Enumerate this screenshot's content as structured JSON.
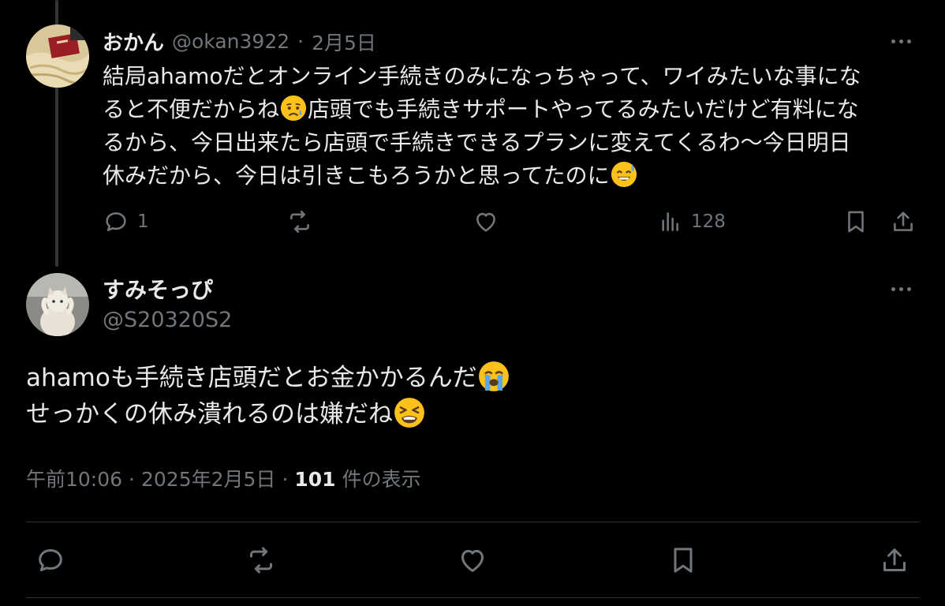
{
  "parent_tweet": {
    "display_name": "おかん",
    "handle": "@okan3922",
    "separator": "·",
    "date": "2月5日",
    "text_parts": [
      "結局ahamoだとオンライン手続きのみになっちゃって、ワイみたいな事にな",
      "ると不便だからね",
      "店頭でも手続きサポートやってるみたいだけど有料にな",
      "るから、今日出来たら店頭で手続きできるプランに変えてくるわ〜今日明日",
      "休みだから、今日は引きこもろうかと思ってたのに"
    ],
    "emojis": [
      "sad-relieved-face-emoji",
      "grinning-sweat-face-emoji"
    ],
    "reply_count": "1",
    "views_count": "128",
    "actions": [
      "reply-icon",
      "retweet-icon",
      "like-icon",
      "views-icon",
      "bookmark-icon",
      "share-icon"
    ]
  },
  "reply_tweet": {
    "display_name": "すみそっぴ",
    "handle": "@S20320S2",
    "text_line1": "ahamoも手続き店頭だとお金かかるんだ",
    "text_line2": "せっかくの休み潰れるのは嫌だね",
    "emojis": [
      "loudly-crying-face-emoji",
      "tired-face-emoji"
    ],
    "meta": {
      "time": "午前10:06",
      "separator": "·",
      "date": "2025年2月5日",
      "separator2": "·",
      "views_count": "101",
      "views_label": "件の表示"
    },
    "actions": [
      "reply-icon",
      "retweet-icon",
      "like-icon",
      "bookmark-icon",
      "share-icon"
    ]
  },
  "colors": {
    "background": "#000000",
    "text_primary": "#e7e9ea",
    "text_secondary": "#71767b",
    "divider": "#2f3336",
    "thread_line": "#333639"
  }
}
